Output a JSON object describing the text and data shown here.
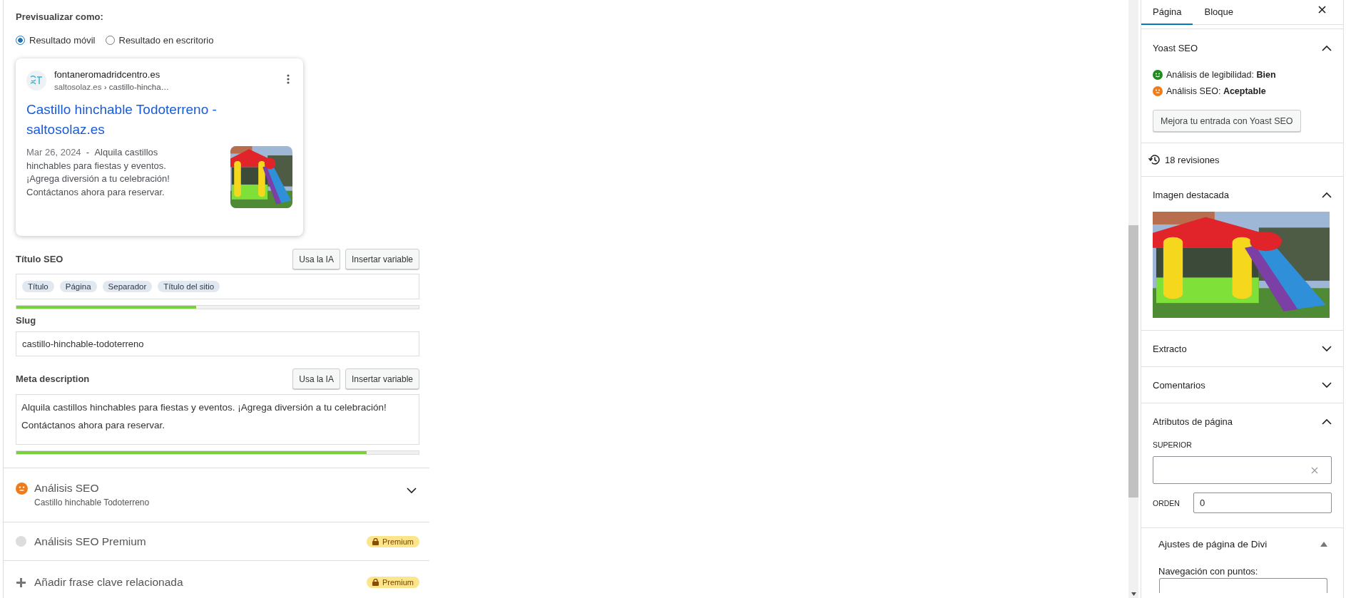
{
  "preview": {
    "label": "Previsualizar como:",
    "options": [
      {
        "label": "Resultado móvil",
        "selected": true
      },
      {
        "label": "Resultado en escritorio",
        "selected": false
      }
    ]
  },
  "snippet": {
    "site_name": "fontaneromadridcentro.es",
    "breadcrumb_domain": "saltosolaz.es",
    "breadcrumb_separator": "›",
    "breadcrumb_path": "castillo-hincha…",
    "title": "Castillo hinchable Todoterreno - saltosolaz.es",
    "date": "Mar 26, 2024",
    "separator": "-",
    "description": "Alquila castillos hinchables para fiestas y eventos. ¡Agrega diversión a tu celebración! Contáctanos ahora para reservar."
  },
  "seo_title": {
    "label": "Título SEO",
    "buttons": [
      "Usa la IA",
      "Insertar variable"
    ],
    "tokens": [
      "Título",
      "Página",
      "Separador",
      "Título del sitio"
    ],
    "level": 0.447
  },
  "slug": {
    "label": "Slug",
    "value": "castillo-hinchable-todoterreno"
  },
  "meta_description": {
    "label": "Meta description",
    "buttons": [
      "Usa la IA",
      "Insertar variable"
    ],
    "value": "Alquila castillos hinchables para fiestas y eventos. ¡Agrega diversión a tu celebración! Contáctanos ahora para reservar.",
    "level": 0.87
  },
  "sections": [
    {
      "kind": "analysis",
      "title": "Análisis SEO",
      "subtitle": "Castillo hinchable Todoterreno",
      "color": "#ee7c1b",
      "expanded": false
    },
    {
      "kind": "premium",
      "title": "Análisis SEO Premium",
      "badge": "Premium",
      "color": "#dddddd"
    },
    {
      "kind": "add",
      "title": "Añadir frase clave relacionada",
      "badge": "Premium"
    }
  ],
  "sidebar": {
    "tabs": [
      {
        "label": "Página",
        "selected": true
      },
      {
        "label": "Bloque",
        "selected": false
      }
    ],
    "yoast": {
      "title": "Yoast SEO",
      "expanded": true,
      "results": [
        {
          "kind": "good",
          "text": "Análisis de legibilidad: **Bien**",
          "color": "#1e8c1e"
        },
        {
          "kind": "ok",
          "text": "Análisis SEO: **Aceptable**",
          "color": "#ee7c1b"
        }
      ],
      "button": "Mejora tu entrada con Yoast SEO"
    },
    "revisions": "18 revisiones",
    "panels": [
      {
        "title": "Imagen destacada",
        "expanded": true
      },
      {
        "kind": "plain",
        "title": "Extracto",
        "expanded": false
      },
      {
        "kind": "plain",
        "title": "Comentarios",
        "expanded": false
      },
      {
        "kind": "attributes",
        "title": "Atributos de página",
        "expanded": true,
        "parent_label": "SUPERIOR",
        "order_label": "ORDEN",
        "order_value": "0"
      },
      {
        "kind": "divi",
        "title": "Ajustes de página de Divi",
        "expanded": true,
        "field_label": "Navegación con puntos:"
      }
    ]
  }
}
